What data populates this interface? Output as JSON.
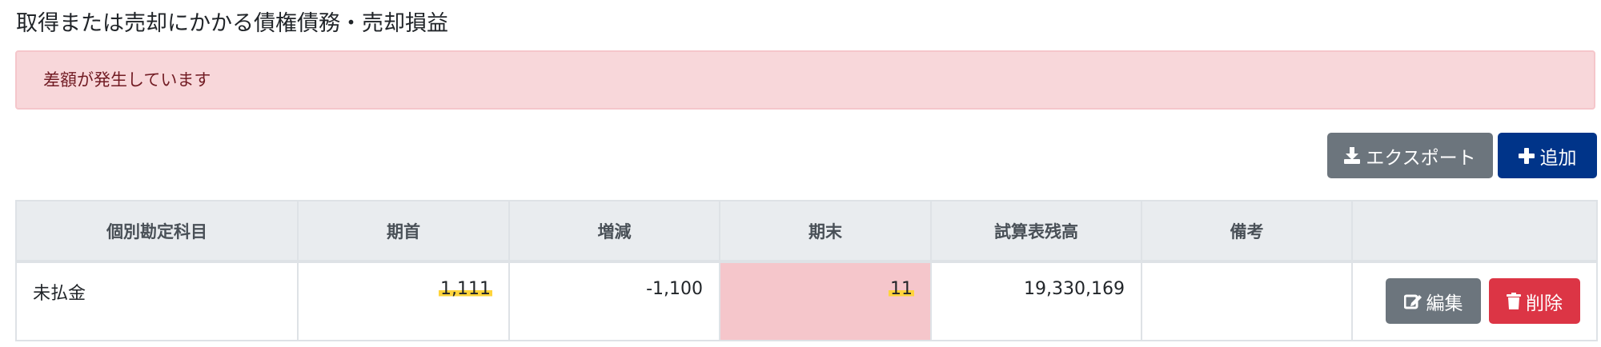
{
  "page": {
    "title": "取得または売却にかかる債権債務・売却損益"
  },
  "alert": {
    "message": "差額が発生しています"
  },
  "toolbar": {
    "export_label": "エクスポート",
    "export_icon": "download-icon",
    "add_label": "追加",
    "add_icon": "plus-icon",
    "export_color": "#6c757d",
    "add_color": "#003489"
  },
  "table": {
    "headers": [
      "個別勘定科目",
      "期首",
      "増減",
      "期末",
      "試算表残高",
      "備考",
      ""
    ],
    "rows": [
      {
        "account": "未払金",
        "opening": "1,111",
        "change": "-1,100",
        "closing": "11",
        "trial_balance": "19,330,169",
        "note": "",
        "edit_label": "編集",
        "edit_icon": "edit-icon",
        "delete_label": "削除",
        "delete_icon": "trash-icon"
      }
    ]
  },
  "colors": {
    "alert_bg": "#f8d7da",
    "diff_cell": "#f5c6cb",
    "highlight": "#ffd43b",
    "delete": "#dc3545"
  }
}
